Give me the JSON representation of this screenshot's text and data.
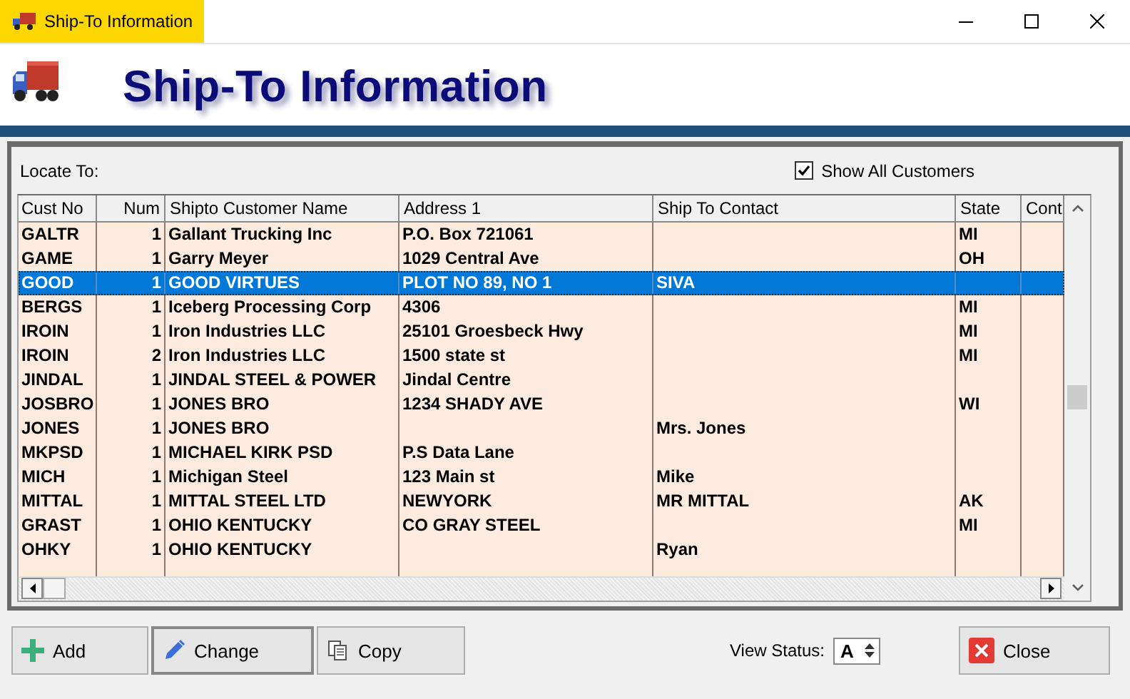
{
  "window": {
    "title": "Ship-To Information"
  },
  "header": {
    "title": "Ship-To Information"
  },
  "locate": {
    "label": "Locate To:"
  },
  "show_all": {
    "label": "Show All Customers",
    "checked": true
  },
  "table": {
    "columns": [
      "Cust No",
      "Num",
      "Shipto Customer Name",
      "Address 1",
      "Ship To Contact",
      "State",
      "Cont"
    ],
    "rows": [
      {
        "cells": [
          "GALTR",
          "1",
          "Gallant Trucking Inc",
          "P.O. Box 721061",
          "",
          "MI",
          ""
        ],
        "selected": false
      },
      {
        "cells": [
          "GAME",
          "1",
          "Garry Meyer",
          "1029 Central Ave",
          "",
          "OH",
          ""
        ],
        "selected": false
      },
      {
        "cells": [
          "GOOD",
          "1",
          "GOOD VIRTUES",
          "PLOT NO 89, NO 1",
          "SIVA",
          "",
          ""
        ],
        "selected": true
      },
      {
        "cells": [
          "BERGS",
          "1",
          "Iceberg Processing Corp",
          "4306",
          "",
          "MI",
          ""
        ],
        "selected": false
      },
      {
        "cells": [
          "IROIN",
          "1",
          "Iron Industries LLC",
          "25101 Groesbeck Hwy",
          "",
          "MI",
          ""
        ],
        "selected": false
      },
      {
        "cells": [
          "IROIN",
          "2",
          "Iron Industries LLC",
          "1500 state st",
          "",
          "MI",
          ""
        ],
        "selected": false
      },
      {
        "cells": [
          "JINDAL",
          "1",
          "JINDAL STEEL & POWER",
          "Jindal Centre",
          "",
          "",
          ""
        ],
        "selected": false
      },
      {
        "cells": [
          "JOSBRO",
          "1",
          "JONES BRO",
          "1234 SHADY AVE",
          "",
          "WI",
          ""
        ],
        "selected": false
      },
      {
        "cells": [
          "JONES",
          "1",
          "JONES BRO",
          "",
          "Mrs. Jones",
          "",
          ""
        ],
        "selected": false
      },
      {
        "cells": [
          "MKPSD",
          "1",
          "MICHAEL KIRK PSD",
          "P.S Data Lane",
          "",
          "",
          ""
        ],
        "selected": false
      },
      {
        "cells": [
          "MICH",
          "1",
          "Michigan Steel",
          "123 Main st",
          "Mike",
          "",
          ""
        ],
        "selected": false
      },
      {
        "cells": [
          "MITTAL",
          "1",
          "MITTAL STEEL LTD",
          "NEWYORK",
          "MR MITTAL",
          "AK",
          ""
        ],
        "selected": false
      },
      {
        "cells": [
          "GRAST",
          "1",
          "OHIO KENTUCKY",
          "CO GRAY STEEL",
          "",
          "MI",
          ""
        ],
        "selected": false
      },
      {
        "cells": [
          "OHKY",
          "1",
          "OHIO KENTUCKY",
          "",
          "Ryan",
          "",
          ""
        ],
        "selected": false
      }
    ]
  },
  "buttons": [
    {
      "label": "Add",
      "kind": "add"
    },
    {
      "label": "Change",
      "kind": "change"
    },
    {
      "label": "Copy",
      "kind": "copy"
    }
  ],
  "view_status": {
    "label": "View Status:",
    "value": "A"
  },
  "close_button": {
    "label": "Close"
  }
}
